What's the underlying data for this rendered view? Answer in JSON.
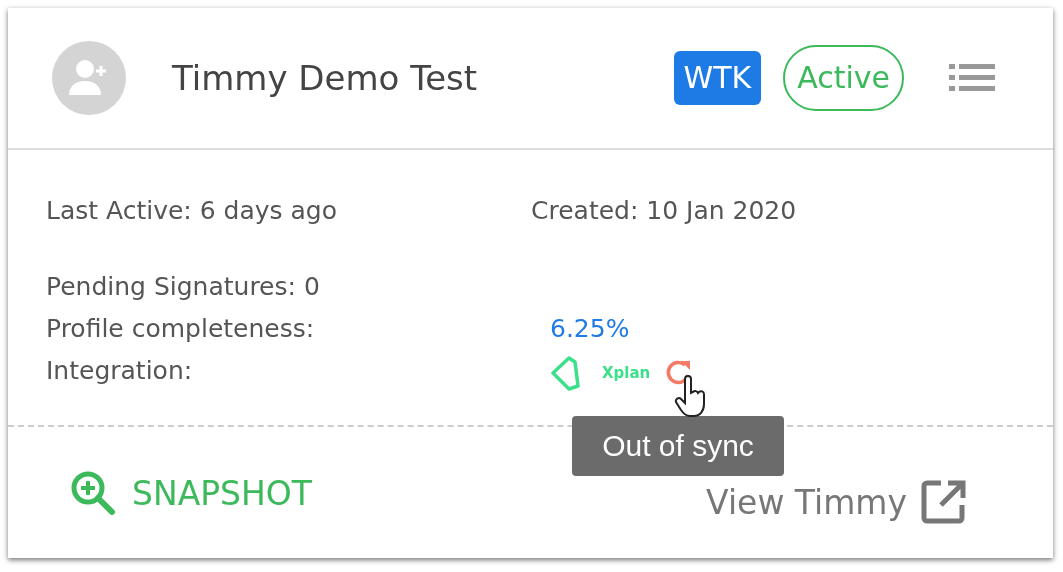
{
  "header": {
    "contact_name": "Timmy Demo Test",
    "badges": [
      {
        "label": "WTK",
        "kind": "solid"
      },
      {
        "label": "Active",
        "kind": "outline"
      }
    ]
  },
  "details": {
    "last_active": "Last Active: 6 days ago",
    "created": "Created: 10 Jan 2020",
    "fields": [
      {
        "kind": "text",
        "label": "Pending Signatures: 0"
      },
      {
        "kind": "value",
        "label": "Profile completeness:",
        "value": "6.25%"
      },
      {
        "kind": "integration",
        "label": "Integration:",
        "provider": "Xplan",
        "tooltip": "Out of sync"
      }
    ]
  },
  "actions": {
    "snapshot": "SNAPSHOT",
    "view": "View Timmy"
  }
}
